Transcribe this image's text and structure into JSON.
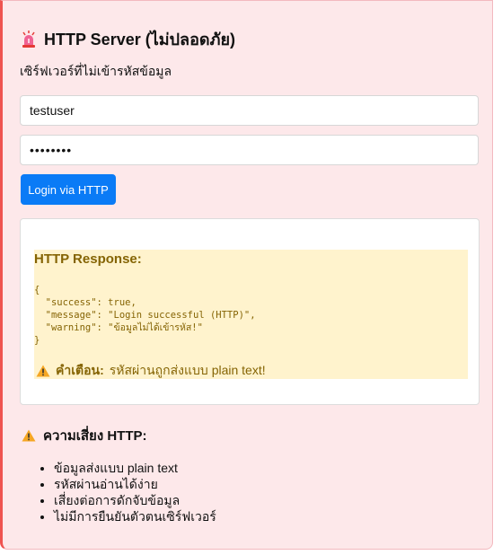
{
  "header": {
    "icon": "siren-icon",
    "title": "HTTP Server (ไม่ปลอดภัย)",
    "subtitle": "เซิร์ฟเวอร์ที่ไม่เข้ารหัสข้อมูล"
  },
  "form": {
    "username_value": "testuser",
    "password_value": "••••••••",
    "login_label": "Login via HTTP"
  },
  "response": {
    "title": "HTTP Response:",
    "json_text": "{\n  \"success\": true,\n  \"message\": \"Login successful (HTTP)\",\n  \"warning\": \"ข้อมูลไม่ได้เข้ารหัส!\"\n}",
    "warning_icon": "warning-icon",
    "warning_label": "คำเตือน:",
    "warning_text": "รหัสผ่านถูกส่งแบบ plain text!"
  },
  "risks": {
    "icon": "warning-icon",
    "title": "ความเสี่ยง HTTP:",
    "items": [
      "ข้อมูลส่งแบบ plain text",
      "รหัสผ่านอ่านได้ง่าย",
      "เสี่ยงต่อการดักจับข้อมูล",
      "ไม่มีการยืนยันตัวตนเซิร์ฟเวอร์"
    ]
  },
  "colors": {
    "panel_bg": "#fde8ea",
    "accent_border": "#ef5350",
    "button_bg": "#0a7bf6",
    "response_bg": "#fff3cd",
    "response_text": "#856404"
  }
}
